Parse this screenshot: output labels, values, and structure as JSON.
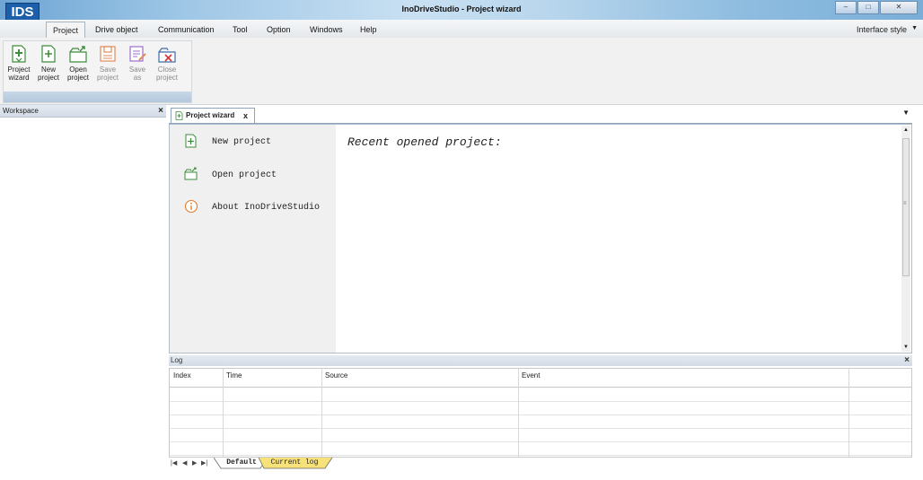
{
  "window": {
    "logo": "IDS",
    "title": "InoDriveStudio - Project wizard",
    "buttons": [
      "minimize",
      "restore",
      "close"
    ]
  },
  "menu": {
    "items": [
      "Project",
      "Drive object",
      "Communication",
      "Tool",
      "Option",
      "Windows",
      "Help"
    ],
    "active": "Project",
    "interface_style": "Interface style"
  },
  "ribbon": {
    "buttons": [
      {
        "line1": "Project",
        "line2": "wizard",
        "icon": "project-wizard-icon",
        "enabled": true
      },
      {
        "line1": "New",
        "line2": "project",
        "icon": "new-project-icon",
        "enabled": true
      },
      {
        "line1": "Open",
        "line2": "project",
        "icon": "open-project-icon",
        "enabled": true
      },
      {
        "line1": "Save",
        "line2": "project",
        "icon": "save-project-icon",
        "enabled": false
      },
      {
        "line1": "Save",
        "line2": "as",
        "icon": "save-as-icon",
        "enabled": false
      },
      {
        "line1": "Close",
        "line2": "project",
        "icon": "close-project-icon",
        "enabled": false
      }
    ]
  },
  "workspace": {
    "title": "Workspace",
    "close": "×"
  },
  "document_tabs": [
    {
      "label": "Project wizard",
      "close": "x"
    }
  ],
  "wizard": {
    "items": [
      {
        "label": "New project",
        "icon": "new-project-icon"
      },
      {
        "label": "Open project",
        "icon": "open-folder-icon"
      },
      {
        "label": "About InoDriveStudio",
        "icon": "info-icon"
      }
    ],
    "recent_title": "Recent opened project:"
  },
  "log": {
    "title": "Log",
    "close": "×",
    "columns": [
      "Index",
      "Time",
      "Source",
      "Event"
    ],
    "empty_rows": 5,
    "sheet_tabs": [
      "Default",
      "Current log"
    ],
    "active_sheet": "Default"
  },
  "colors": {
    "accent_blue": "#1d5fa8",
    "ribbon_icon_green": "#3c8d3c",
    "close_red": "#d23a3a",
    "sheet_tab_yellow": "#f7e27a"
  }
}
